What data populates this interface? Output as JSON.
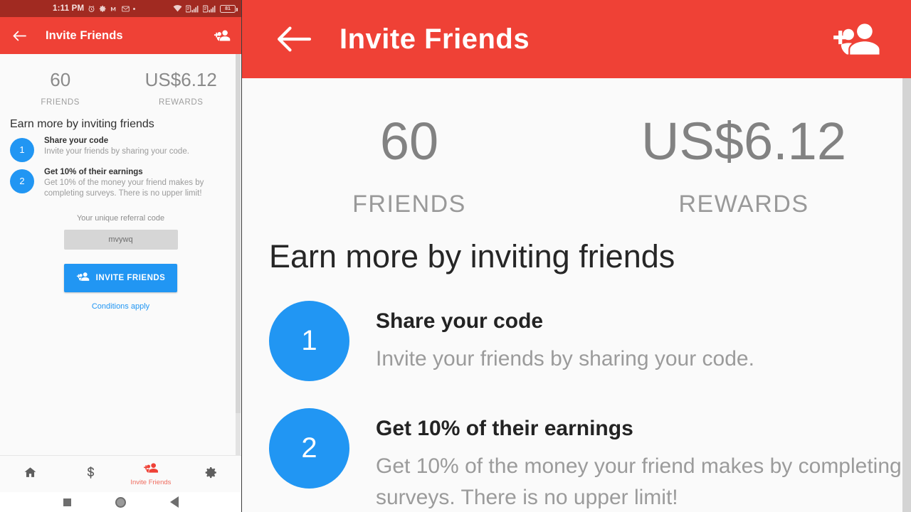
{
  "statusbar": {
    "time": "1:11 PM",
    "icons": [
      "alarm-icon",
      "settings-icon",
      "medium-app-icon",
      "gmail-icon",
      "dot-icon"
    ],
    "right_icons": [
      "wifi-icon",
      "sim1-signal-icon",
      "sim2-signal-icon"
    ],
    "battery_level": "81"
  },
  "appbar": {
    "back_icon": "arrow-left-icon",
    "title": "Invite Friends",
    "action_icon": "person-add-icon"
  },
  "stats": [
    {
      "value": "60",
      "label": "FRIENDS"
    },
    {
      "value": "US$6.12",
      "label": "REWARDS"
    }
  ],
  "earn_title": "Earn more by inviting friends",
  "steps": [
    {
      "num": "1",
      "heading": "Share your code",
      "body": "Invite your friends by sharing your code."
    },
    {
      "num": "2",
      "heading": "Get 10% of their earnings",
      "body": "Get 10% of the money your friend makes by completing surveys. There is no upper limit!"
    }
  ],
  "referral": {
    "caption": "Your unique referral code",
    "code": "mvywq"
  },
  "invite_button": {
    "label": "INVITE FRIENDS",
    "icon": "person-add-icon"
  },
  "conditions_link": "Conditions apply",
  "bottom_tabs": [
    {
      "icon": "home-icon",
      "label": "",
      "active": false
    },
    {
      "icon": "dollar-icon",
      "label": "",
      "active": false
    },
    {
      "icon": "person-add-icon",
      "label": "Invite Friends",
      "active": true
    },
    {
      "icon": "gear-icon",
      "label": "",
      "active": false
    }
  ],
  "android_nav": [
    "recents-square-icon",
    "home-circle-icon",
    "back-triangle-icon"
  ],
  "colors": {
    "brand_red": "#ef4136",
    "status_red": "#a12a21",
    "accent_blue": "#2196f3",
    "tab_active": "#ef6b5e",
    "body_bg": "#fafafa",
    "muted_text": "#9b9b9b"
  },
  "magnified": {
    "note": "magnified-duplicate-of-phone-screen"
  }
}
